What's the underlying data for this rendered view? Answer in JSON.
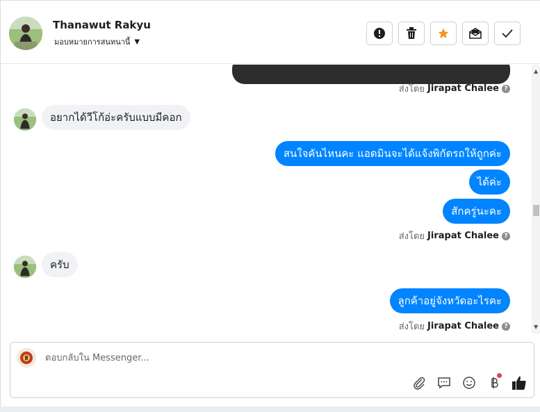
{
  "header": {
    "contact_name": "Thanawut Rakyu",
    "assign_label": "มอบหมายการสนทนานี้",
    "actions": [
      "spam",
      "delete",
      "star",
      "mark-unread",
      "done"
    ],
    "star_color": "#f7931e"
  },
  "thread": {
    "messages": [
      {
        "dir": "out",
        "text": "",
        "style": "dark"
      },
      {
        "dir": "meta",
        "prefix": "ส่งโดย",
        "name": "Jirapat Chalee"
      },
      {
        "dir": "in",
        "text": "อยากได้วีโก้อ่ะครับแบบมีคอก"
      },
      {
        "dir": "out",
        "text": "สนใจคันไหนคะ แอดมินจะได้แจ้งพิกัดรถให้ถูกค่ะ"
      },
      {
        "dir": "out",
        "text": "ได้ค่ะ"
      },
      {
        "dir": "out",
        "text": "สักครู่นะคะ"
      },
      {
        "dir": "meta",
        "prefix": "ส่งโดย",
        "name": "Jirapat Chalee"
      },
      {
        "dir": "in",
        "text": "ครับ"
      },
      {
        "dir": "out",
        "text": "ลูกค้าอยู่จังหวัดอะไรคะ"
      },
      {
        "dir": "meta",
        "prefix": "ส่งโดย",
        "name": "Jirapat Chalee"
      }
    ],
    "outgoing_color": "#0084ff",
    "incoming_color": "#f0f2f5"
  },
  "composer": {
    "placeholder": "ตอบกลับใน Messenger...",
    "tools": [
      "paperclip-icon",
      "saved-reply-icon",
      "emoji-icon",
      "baht-payment-icon",
      "like-icon"
    ]
  }
}
